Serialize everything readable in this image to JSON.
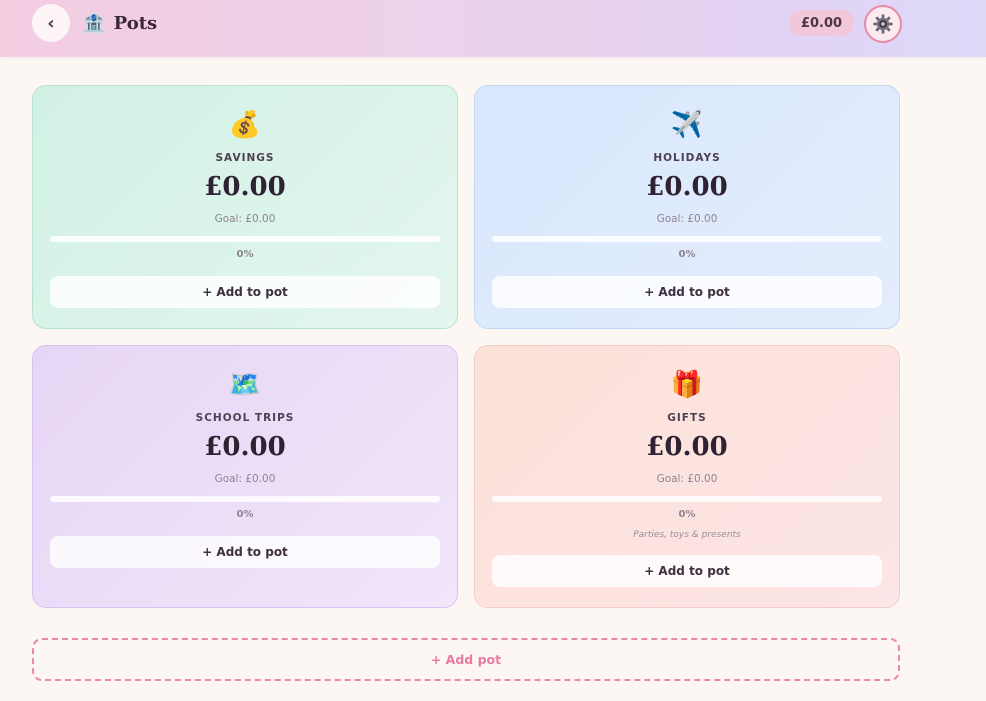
{
  "header": {
    "back_label": "‹",
    "title_icon": "🏦",
    "title": "Pots",
    "balance": "£0.00",
    "settings_icon": "⚙️"
  },
  "pots": [
    {
      "icon": "💰",
      "name": "SAVINGS",
      "amount": "£0.00",
      "goal": "Goal: £0.00",
      "percent": "0%",
      "progress": 0,
      "description": "",
      "add_label": "+ Add to pot",
      "color": "#d2f1e5"
    },
    {
      "icon": "✈️",
      "name": "HOLIDAYS",
      "amount": "£0.00",
      "goal": "Goal: £0.00",
      "percent": "0%",
      "progress": 0,
      "description": "",
      "add_label": "+ Add to pot",
      "color": "#d9e7fd"
    },
    {
      "icon": "🗺️",
      "name": "SCHOOL TRIPS",
      "amount": "£0.00",
      "goal": "Goal: £0.00",
      "percent": "0%",
      "progress": 0,
      "description": "",
      "add_label": "+ Add to pot",
      "color": "#e6d6f6"
    },
    {
      "icon": "🎁",
      "name": "GIFTS",
      "amount": "£0.00",
      "goal": "Goal: £0.00",
      "percent": "0%",
      "progress": 0,
      "description": "Parties, toys & presents",
      "add_label": "+ Add to pot",
      "color": "#fbe2d8"
    }
  ],
  "add_pot_label": "+ Add pot",
  "colors": {
    "accent": "#e88aa6",
    "background": "#fdf7f4"
  }
}
